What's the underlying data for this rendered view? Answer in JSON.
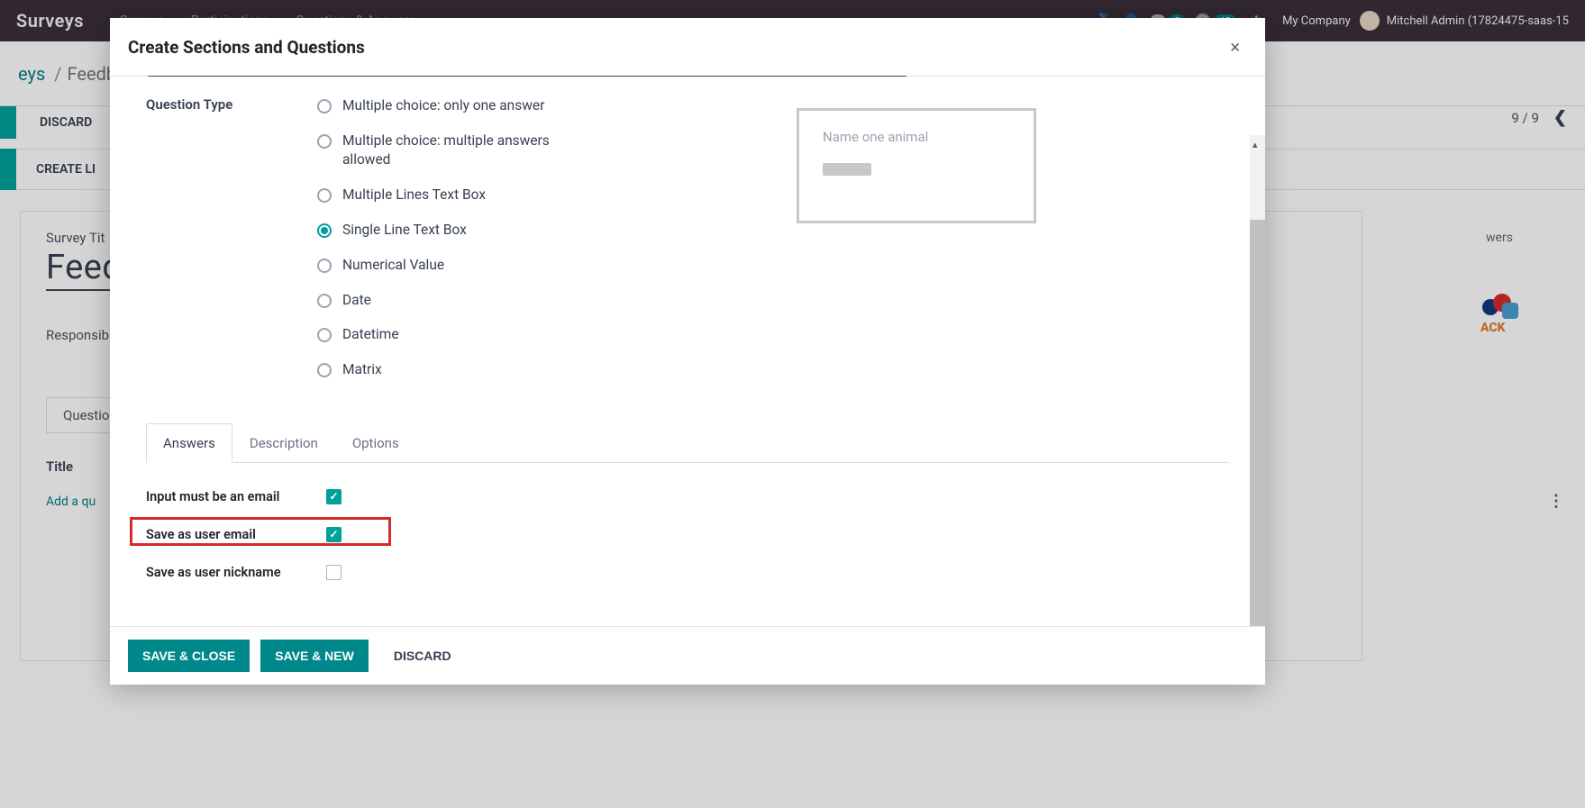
{
  "bg": {
    "app_title": "Surveys",
    "menu": [
      "Surveys",
      "Participations",
      "Questions & Answers"
    ],
    "badge1": "2",
    "badge2": "42",
    "company": "My Company",
    "user": "Mitchell Admin (17824475-saas-15",
    "crumb_link": "eys",
    "crumb_sep": "/",
    "crumb_cur": "Feedba",
    "discard": "DISCARD",
    "create_link": "CREATE LI",
    "pagination": "9 / 9",
    "card": {
      "survey_title_label": "Survey Tit",
      "survey_title_value": "Feed",
      "responsible_label": "Responsib",
      "tab_questions": "Questio",
      "table_head": "Title",
      "add_line": "Add a qu",
      "right_label": "wers",
      "logo_text": "ACK"
    }
  },
  "modal": {
    "title": "Create Sections and Questions",
    "question_type_label": "Question Type",
    "options": [
      {
        "label": "Multiple choice: only one answer",
        "selected": false
      },
      {
        "label": "Multiple choice: multiple answers allowed",
        "selected": false
      },
      {
        "label": "Multiple Lines Text Box",
        "selected": false
      },
      {
        "label": "Single Line Text Box",
        "selected": true
      },
      {
        "label": "Numerical Value",
        "selected": false
      },
      {
        "label": "Date",
        "selected": false
      },
      {
        "label": "Datetime",
        "selected": false
      },
      {
        "label": "Matrix",
        "selected": false
      }
    ],
    "preview": {
      "title": "Name one animal"
    },
    "tabs": [
      {
        "label": "Answers",
        "active": true
      },
      {
        "label": "Description",
        "active": false
      },
      {
        "label": "Options",
        "active": false
      }
    ],
    "answers": {
      "rows": [
        {
          "label": "Input must be an email",
          "checked": true,
          "highlighted": false,
          "name": "input-must-be-email"
        },
        {
          "label": "Save as user email",
          "checked": true,
          "highlighted": true,
          "name": "save-as-user-email"
        },
        {
          "label": "Save as user nickname",
          "checked": false,
          "highlighted": false,
          "name": "save-as-user-nickname"
        }
      ]
    },
    "footer": {
      "save_close": "SAVE & CLOSE",
      "save_new": "SAVE & NEW",
      "discard": "DISCARD"
    }
  }
}
